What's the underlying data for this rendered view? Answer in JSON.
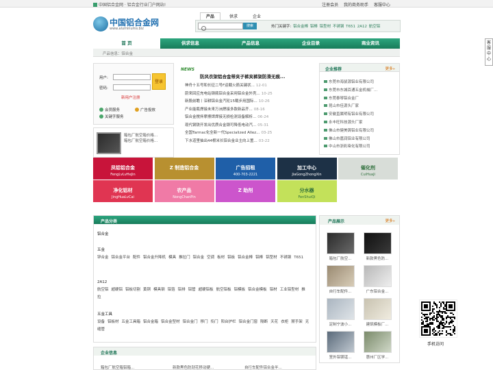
{
  "topbar": {
    "left": "中国铝合金网 · 铝合金行业门户网站!",
    "links": [
      "注册会员",
      "我的商务助手",
      "客服中心"
    ]
  },
  "logo": {
    "title": "中国铝合金网",
    "url": "www.aluminums.biz"
  },
  "search": {
    "tabs": [
      "产品",
      "供求",
      "企业"
    ],
    "button": "搜索",
    "hot_label": "热门关键字:",
    "hot": [
      "铝合金棒",
      "铝棒",
      "铝型材",
      "不锈钢",
      "T651",
      "2A12",
      "航空铝"
    ]
  },
  "nav": [
    "首 页",
    "供求信息",
    "产品信息",
    "企业目录",
    "商业资讯"
  ],
  "subnav": "产品信息：铝合金",
  "login": {
    "user": "用户:",
    "pass": "密码:",
    "go": "登录",
    "register": "新用户注册",
    "services": [
      "会员服务",
      "广告投放",
      "关键字服务"
    ]
  },
  "pad": {
    "lines": [
      "箱包厂航空箱价格...",
      "箱包厂航空箱价格..."
    ]
  },
  "news": {
    "tag": "NEWS",
    "headline": "防风衣架铝合金带夹子裤夹裤架防滑无痕...",
    "items": [
      {
        "t": "神舟十五号和长征二号F运载火箭关键状...",
        "d": "12-01"
      },
      {
        "t": "蔚来回应充电站钢瓶铝合金采用铝合金外壳...",
        "d": "10-25"
      },
      {
        "t": "新股前瞻丨深耕铝合金汽轮15载步用国际...",
        "d": "10-26"
      },
      {
        "t": "产业能瓶焊接未来万洲焊接多款新品齐...",
        "d": "08-16"
      },
      {
        "t": "铝合金搅拌摩擦焊焊接无损检测设备解析...",
        "d": "06-24"
      },
      {
        "t": "现代钢铁开发出优质合金钢可降低电动汽...",
        "d": "05-31"
      },
      {
        "t": "全国Tarmac化全新一代Specialized Allez...",
        "d": "03-25"
      },
      {
        "t": "下水道里抽出44根米长铝合金业主向上置...",
        "d": "03-22"
      }
    ]
  },
  "enterprise": {
    "title": "企业推荐",
    "more": "更多»",
    "items": [
      "东莞市海鼠源铝业有限公司",
      "东莞市东城百通五金机械厂...",
      "东莞泰琴铝合金厂",
      "昆山市佳源头厂家",
      "安徽直属明有铝业有限公司",
      "永丰旺科技源头厂家",
      "佛山市健美铸铝业有限公司",
      "佛山市嘉润铝业有限公司",
      "中山市浙彩染化有限公司"
    ]
  },
  "banners": [
    {
      "t": "凤铝铝合金",
      "s": "FengLvLvHeJin",
      "c": "#c8143a"
    },
    {
      "t": "Z 制造铝合金",
      "s": "",
      "c": "#b89030"
    },
    {
      "t": "广告招租",
      "s": "400-703-2221",
      "c": "#1f5fa8"
    },
    {
      "t": "加工中心",
      "s": "JiaGongZhongXin",
      "c": "#1d3146"
    },
    {
      "t": "催化剂",
      "s": "CuiHuaJi",
      "c": "#d8ddd8"
    },
    {
      "t": "净化铝材",
      "s": "JingHuaLvCai",
      "c": "#e03552"
    },
    {
      "t": "农产品",
      "s": "NongChanPin",
      "c": "#f07aa6"
    },
    {
      "t": "Z 助剂",
      "s": "",
      "c": "#cc55cc"
    },
    {
      "t": "分水器",
      "s": "FenShuiQi",
      "c": "#c3e15a"
    }
  ],
  "category": {
    "title": "产品分类",
    "groups": [
      {
        "tt": "铝合金",
        "items": []
      },
      {
        "tt": "五金",
        "items": [
          "锌合金",
          "铝合金平台",
          "配件",
          "铝合金升降机",
          "模具",
          "推拉门",
          "铝合金",
          "空调",
          "板材",
          "铝板",
          "铝合金棒",
          "铝棒",
          "铝型材",
          "不锈钢",
          "T651"
        ]
      },
      {
        "tt": "2A12",
        "items": [
          "航空铝",
          "超硬铝",
          "铝板切割",
          "黄铜",
          "模具钢",
          "铝箔",
          "铝排",
          "铝管",
          "超硬铝板",
          "航空铝板",
          "铝模板",
          "铝合金模板",
          "铝材",
          "工业铝型材",
          "推拉"
        ]
      },
      {
        "tt": "五金工具",
        "items": [
          "设备",
          "铝板材",
          "五金工具箱",
          "铝合金箱",
          "铝合金型材",
          "铝合金门",
          "移门",
          "衔门",
          "阳台护栏",
          "铝合金门窗",
          "隔断",
          "天花",
          "衣柜",
          "掰手架",
          "无缝管"
        ]
      }
    ]
  },
  "products": {
    "title": "产品展示",
    "more": "更多»",
    "items": [
      "箱包厂航空...",
      "新款黑色防...",
      "自行车配件...",
      "广东铝合金...",
      "定制宁波小...",
      "建筑模板厂...",
      "室外铝镁锰...",
      "惠州厂区学..."
    ]
  },
  "side": "客服中心",
  "qr_label": "手机访问",
  "footer": {
    "title": "企业信息",
    "items": [
      "箱包厂航空箱铝箱...",
      "新款黑色防刮花移动硬...",
      "自行车配件铝合金半..."
    ]
  }
}
